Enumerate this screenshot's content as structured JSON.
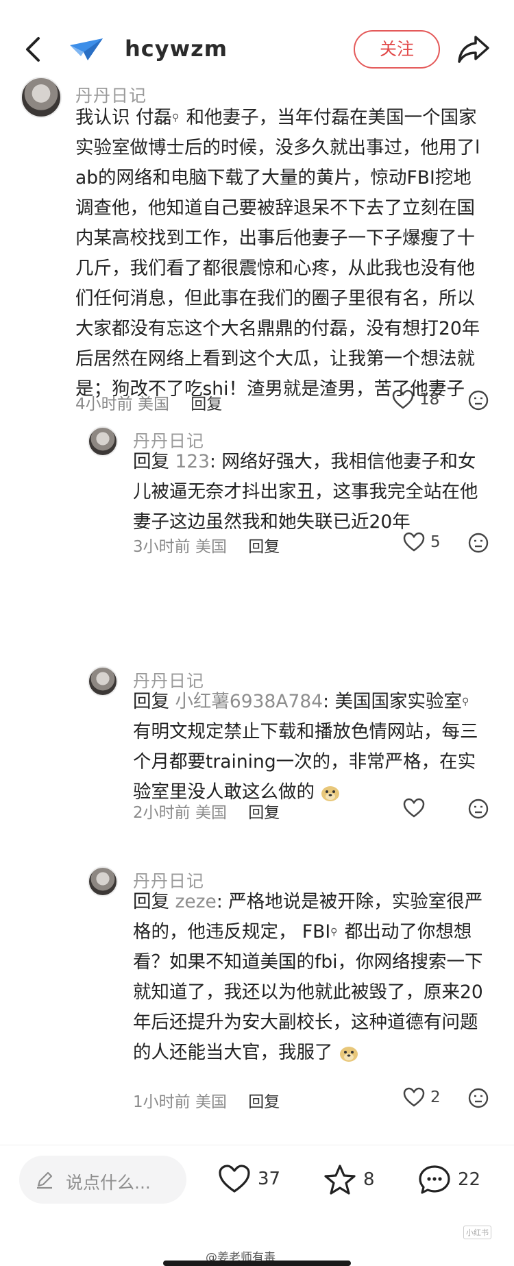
{
  "header": {
    "username": "hcywzm",
    "follow_label": "关注"
  },
  "comments": [
    {
      "author": "丹丹日记",
      "text_before_mention": "我认识 ",
      "mention": "付磊",
      "text_after_mention": " 和他妻子，当年付磊在美国一个国家实验室做博士后的时候，没多久就出事过，他用了lab的网络和电脑下载了大量的黄片，惊动FBI挖地调查他，他知道自己要被辞退呆不下去了立刻在国内某高校找到工作，出事后他妻子一下子爆瘦了十几斤，我们看了都很震惊和心疼，从此我也没有他们任何消息，但此事在我们的圈子里很有名，所以大家都没有忘这个大名鼎鼎的付磊，没有想打20年后居然在网络上看到这个大瓜，让我第一个想法就是；狗改不了吃shi！渣男就是渣男，苦了他妻子",
      "time": "4小时前",
      "location": "美国",
      "reply_label": "回复",
      "likes": "18"
    },
    {
      "author": "丹丹日记",
      "reply_prefix": "回复 ",
      "reply_target": "123",
      "text": ": 网络好强大，我相信他妻子和女儿被逼无奈才抖出家丑，这事我完全站在他妻子这边虽然我和她失联已近20年",
      "time": "3小时前",
      "location": "美国",
      "reply_label": "回复",
      "likes": "5"
    },
    {
      "author": "丹丹日记",
      "reply_prefix": "回复 ",
      "reply_target": "小红薯6938A784",
      "text_a": ": 美国国家实验室",
      "text_b": "有明文规定禁止下载和播放色情网站，每三个月都要training一次的，非常严格，在实验室里没人敢这么做的",
      "time": "2小时前",
      "location": "美国",
      "reply_label": "回复",
      "likes": ""
    },
    {
      "author": "丹丹日记",
      "reply_prefix": "回复 ",
      "reply_target": "zeze",
      "text_a": ": 严格地说是被开除，实验室很严格的，他违反规定， FBI",
      "text_b": " 都出动了你想想看？如果不知道美国的fbi，你网络搜索一下就知道了，我还以为他就此被毁了，原来20年后还提升为安大副校长，这种道德有问题的人还能当大官，我服了",
      "time": "1小时前",
      "location": "美国",
      "reply_label": "回复",
      "likes": "2"
    }
  ],
  "bottom_bar": {
    "input_placeholder": "说点什么...",
    "like_count": "37",
    "star_count": "8",
    "comment_count": "22"
  },
  "watermark": {
    "small_logo": "小红书",
    "credit": "@姜老师有毒"
  }
}
